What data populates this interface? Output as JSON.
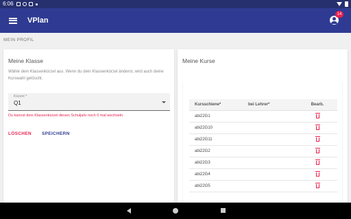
{
  "statusbar": {
    "time": "6:06"
  },
  "appbar": {
    "title": "VPlan",
    "badge": "14"
  },
  "section_label": "MEIN PROFIL",
  "class_card": {
    "title": "Meine Klasse",
    "description": "Wähle dein Klassenkürzel aus. Wenn du dein Klassenkürzel änderst, wird auch deine Kurswahl gelöscht.",
    "field_label": "Kürzel *",
    "field_value": "Q1",
    "hint": "Du kannst dein Klassenkürzel dieses Schuljahr noch 0 mal wechseln.",
    "delete_label": "LÖSCHEN",
    "save_label": "SPEICHERN"
  },
  "courses_card": {
    "title": "Meine Kurse",
    "headers": [
      "Kursschiene*",
      "bei Lehrer*",
      "Bearb."
    ],
    "rows": [
      {
        "course": "abi22G1",
        "teacher": ""
      },
      {
        "course": "abi22G10",
        "teacher": ""
      },
      {
        "course": "abi22G11",
        "teacher": ""
      },
      {
        "course": "abi22G2",
        "teacher": ""
      },
      {
        "course": "abi22G3",
        "teacher": ""
      },
      {
        "course": "abi22G4",
        "teacher": ""
      },
      {
        "course": "abi22G5",
        "teacher": ""
      }
    ]
  },
  "colors": {
    "primary": "#2f3b92",
    "statusbar": "#26306f",
    "accent": "#e9204f"
  },
  "icons": [
    "menu-icon",
    "account-icon",
    "trash-icon",
    "dropdown-caret-icon",
    "nav-back-icon",
    "nav-home-icon",
    "nav-recent-icon"
  ]
}
